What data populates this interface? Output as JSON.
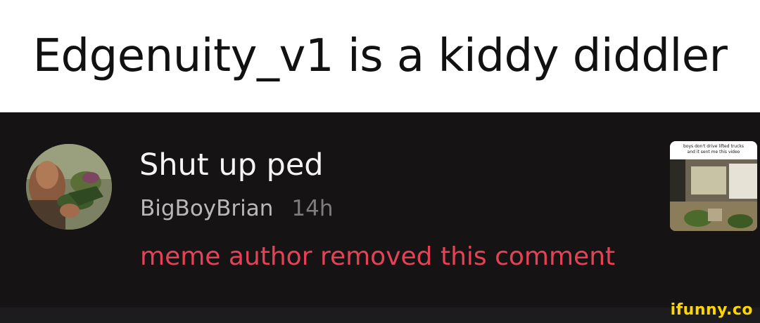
{
  "caption": {
    "text": "Edgenuity_v1 is a kiddy diddler"
  },
  "comment": {
    "text": "Shut up ped",
    "username": "BigBoyBrian",
    "time": "14h",
    "removed_note": "meme author removed this comment"
  },
  "thumbnail": {
    "caption_line1": "boys don't drive lifted trucks",
    "caption_line2": "and it sent me this video"
  },
  "watermark": {
    "text": "ifunny.co"
  },
  "colors": {
    "background_dark": "#151314",
    "removed_note": "#e64257",
    "watermark": "#ffd600"
  }
}
